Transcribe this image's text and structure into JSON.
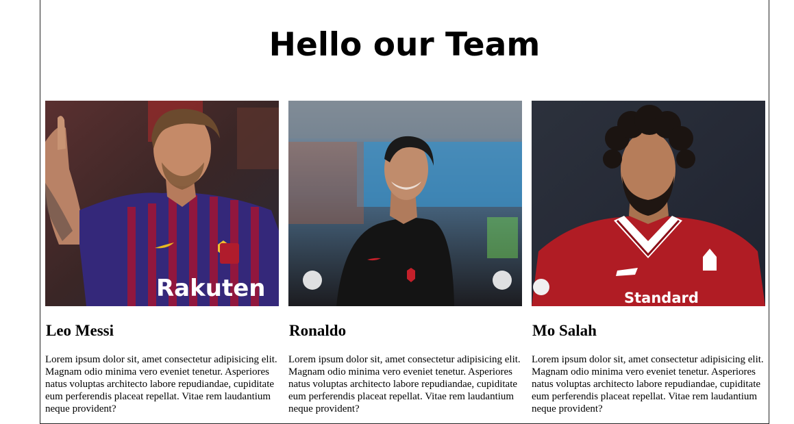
{
  "page": {
    "title": "Hello our Team"
  },
  "team": [
    {
      "name": "Leo Messi",
      "bio": "Lorem ipsum dolor sit, amet consectetur adipisicing elit. Magnam odio minima vero eveniet tenetur. Asperiores natus voluptas architecto labore repudiandae, cupiditate eum perferendis placeat repellat. Vitae rem laudantium neque provident?",
      "photo_subject": "player in red and blue striped jersey with sponsor text",
      "jersey_text": "Rakuten",
      "colors": {
        "jersey": "#3a2d7a",
        "stripe": "#b0183a",
        "bg": "#4a2a2a",
        "skin": "#c98d6a",
        "hair": "#6b4a2e"
      }
    },
    {
      "name": "Ronaldo",
      "bio": "Lorem ipsum dolor sit, amet consectetur adipisicing elit. Magnam odio minima vero eveniet tenetur. Asperiores natus voluptas architecto labore repudiandae, cupiditate eum perferendis placeat repellat. Vitae rem laudantium neque provident?",
      "photo_subject": "smiling player in black jersey",
      "jersey_text": "",
      "colors": {
        "jersey": "#151515",
        "bg": "#6b7a8a",
        "skin": "#c08a6a",
        "hair": "#1a1a1a"
      }
    },
    {
      "name": "Mo Salah",
      "bio": "Lorem ipsum dolor sit, amet consectetur adipisicing elit. Magnam odio minima vero eveniet tenetur. Asperiores natus voluptas architecto labore repudiandae, cupiditate eum perferendis placeat repellat. Vitae rem laudantium neque provident?",
      "photo_subject": "player with curly hair in red jersey with sponsor text",
      "jersey_text": "Standard",
      "colors": {
        "jersey": "#b01c24",
        "bg": "#2b2f3a",
        "skin": "#b07a58",
        "hair": "#1b1411"
      }
    }
  ]
}
